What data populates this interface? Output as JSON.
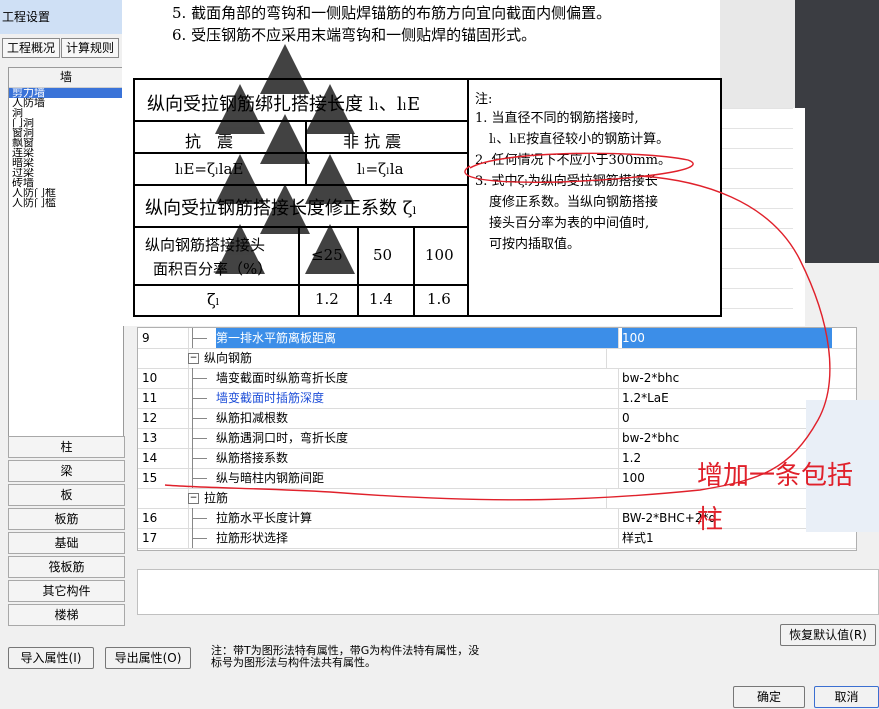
{
  "window": {
    "title": "工程设置"
  },
  "tabs": [
    {
      "label": "工程概况"
    },
    {
      "label": "计算规则"
    }
  ],
  "left_panel": {
    "header": "墙",
    "items": [
      {
        "label": "剪力墙",
        "selected": true
      },
      {
        "label": "人防墙"
      },
      {
        "label": "洞"
      },
      {
        "label": "门洞"
      },
      {
        "label": "窗洞"
      },
      {
        "label": "飘窗"
      },
      {
        "label": "连梁"
      },
      {
        "label": "暗梁"
      },
      {
        "label": "过梁"
      },
      {
        "label": "砖墙"
      },
      {
        "label": "人防门框"
      },
      {
        "label": "人防门槛"
      }
    ]
  },
  "categories": [
    {
      "label": "柱"
    },
    {
      "label": "梁"
    },
    {
      "label": "板"
    },
    {
      "label": "板筋"
    },
    {
      "label": "基础"
    },
    {
      "label": "筏板筋"
    },
    {
      "label": "其它构件"
    },
    {
      "label": "楼梯"
    }
  ],
  "document": {
    "line1": "5. 截面角部的弯钩和一侧贴焊锚筋的布筋方向宜向截面内侧偏置。",
    "line2": "6. 受压钢筋不应采用末端弯钩和一侧贴焊的锚固形式。",
    "table_title1": "纵向受拉钢筋绑扎搭接长度 lₗ、lₗE",
    "seismic": "抗　震",
    "non_seismic": "非 抗 震",
    "formula1": "lₗE=ζₗlaE",
    "formula2": "lₗ=ζₗla",
    "table_title2": "纵向受拉钢筋搭接长度修正系数 ζₗ",
    "area_label1": "纵向钢筋搭接接头",
    "area_label2": "面积百分率（%）",
    "pct": [
      "≤25",
      "50",
      "100"
    ],
    "zeta_symbol": "ζₗ",
    "zeta": [
      "1.2",
      "1.4",
      "1.6"
    ],
    "notes_title": "注:",
    "notes": [
      "1. 当直径不同的钢筋搭接时,",
      "lₗ、lₗE按直径较小的钢筋计算。",
      "2. 任何情况下不应小于300mm。",
      "3. 式中ζₗ为纵向受拉钢筋搭接长",
      "度修正系数。当纵向钢筋搭接",
      "接头百分率为表的中间值时,",
      "可按内插取值。"
    ]
  },
  "table": {
    "rows": [
      {
        "num": "9",
        "name": "第一排水平筋离板距离",
        "value": "100",
        "selected": true
      },
      {
        "num": "",
        "name": "纵向钢筋",
        "value": "",
        "group": true
      },
      {
        "num": "10",
        "name": "墙变截面时纵筋弯折长度",
        "value": "bw-2*bhc"
      },
      {
        "num": "11",
        "name": "墙变截面时插筋深度",
        "value": "1.2*LaE",
        "blue": true
      },
      {
        "num": "12",
        "name": "纵筋扣减根数",
        "value": "0"
      },
      {
        "num": "13",
        "name": "纵筋遇洞口时，弯折长度",
        "value": "bw-2*bhc"
      },
      {
        "num": "14",
        "name": "纵筋搭接系数",
        "value": "1.2"
      },
      {
        "num": "15",
        "name": "纵与暗柱内钢筋间距",
        "value": "100"
      },
      {
        "num": "",
        "name": "拉筋",
        "value": "",
        "group": true
      },
      {
        "num": "16",
        "name": "拉筋水平长度计算",
        "value": "BW-2*BHC+2*d"
      },
      {
        "num": "17",
        "name": "拉筋形状选择",
        "value": "样式1"
      }
    ]
  },
  "annotation": {
    "line1": "增加一条包括",
    "line2": "柱"
  },
  "buttons": {
    "import": "导入属性(I)",
    "export": "导出属性(O)",
    "restore": "恢复默认值(R)",
    "ok": "确定",
    "cancel": "取消"
  },
  "hint": "注：带T为图形法特有属性，带G为构件法特有属性，没标号为图形法与构件法共有属性。",
  "colors": {
    "selection": "#3c8ee8",
    "annotation": "#e0212b",
    "link_blue": "#1f4fd8"
  }
}
